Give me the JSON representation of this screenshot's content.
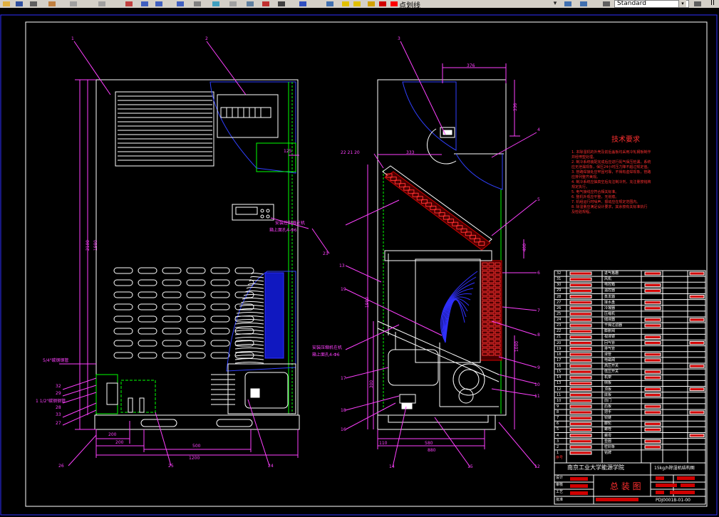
{
  "toolbar": {
    "layer_name": "点划线",
    "text_style": "Standard",
    "right_fragment": "II"
  },
  "colors": {
    "background": "#000000",
    "frame": "#ffffff",
    "dimension": "#ff40ff",
    "detail": "#00ff00",
    "evaporator_fins": "#0000ff",
    "notes": "#ff3030",
    "table_lines": "#ffffff"
  },
  "front_view": {
    "callouts": [
      "1",
      "2"
    ],
    "dimensions": {
      "height": "2100",
      "height_inner": "1980",
      "bottom_left": "200",
      "bottom_mid": "200",
      "bottom_width": "500",
      "total_width": "1200",
      "side": "125"
    },
    "labels": {
      "rear_pipe_1": "5/4\"碳钢钢管",
      "rear_pipe_2": "1 1/2\"碳钢钢管",
      "controller_mount": "安装控制器在机",
      "controller_mount_2": "箱上面孔4-Φ6",
      "small_nums": [
        "32",
        "29",
        "28",
        "33",
        "27",
        "26"
      ],
      "bottom_callouts": [
        "25",
        "24",
        "23"
      ]
    }
  },
  "side_view": {
    "callouts": [
      "3",
      "4",
      "5",
      "6",
      "7",
      "8",
      "9",
      "10",
      "11",
      "12",
      "13",
      "14",
      "15",
      "16",
      "17",
      "18",
      "19"
    ],
    "dimensions": {
      "top_width": "376",
      "top_height": "336",
      "evap_offset": "333",
      "evap_height": "400",
      "height": "1980",
      "lower_height": "1000",
      "bottom_left": "110",
      "bottom_mid": "580",
      "bottom_total": "880",
      "lower_left": "300"
    },
    "labels": {
      "top_nums": "22  21  20",
      "compressor_mount": "安装压缩机在机",
      "compressor_mount_2": "箱上面孔4-Φ6"
    }
  },
  "technical_notes": {
    "title": "技术要求",
    "items": [
      "1. 本除湿机的外壳及前后盖板均采用冷轧钢板制作",
      "   并经喷塑处理。",
      "2. 制冷系统装配完成后应进行氮气保压检漏，系统",
      "   应无泄漏现象，保压24小时压力降不超过规定值。",
      "3. 管路焊接处应牢固可靠，不得有虚焊现象，管路",
      "   应排列整齐美观。",
      "4. 制冷系统应抽真空后充注制冷剂，充注量按铭牌",
      "   规定执行。",
      "5. 电气接线应符合相关标准。",
      "6. 整机外观应平整，无划痕。",
      "7. 机组运行时噪声、振动应在规定范围内。",
      "8. 除湿量应满足设计要求，其余按有关标准执行",
      "   及检验规程。"
    ]
  },
  "title_block": {
    "school": "南京工业大学能源学院",
    "product": "15kg/h除湿机结构图",
    "drawing_name": "总 装 图",
    "drawing_no": "PDJ0001B-01-00",
    "rows": [
      "32",
      "31",
      "30",
      "29",
      "28",
      "27",
      "26",
      "25",
      "24",
      "23",
      "22",
      "21",
      "20",
      "19",
      "18",
      "17",
      "16",
      "15",
      "14",
      "13",
      "12",
      "11",
      "10",
      "9",
      "8",
      "7",
      "6",
      "5",
      "4",
      "3",
      "2",
      "1"
    ],
    "header_row": "序号",
    "part_names": [
      "进气格栅",
      "风机",
      "电控箱",
      "温控器",
      "蒸发器",
      "接水盘",
      "冷凝器",
      "压缩机",
      "储液器",
      "干燥过滤器",
      "膨胀阀",
      "视液镜",
      "回气管",
      "排气管",
      "液管",
      "电磁阀",
      "高压开关",
      "低压开关",
      "机架",
      "侧板",
      "顶板",
      "底板",
      "前门",
      "后板",
      "把手",
      "铰链",
      "脚轮",
      "螺栓",
      "螺母",
      "垫圈",
      "密封条",
      "铭牌"
    ],
    "left_labels": [
      "设计",
      "审核",
      "工艺",
      "批准"
    ]
  }
}
